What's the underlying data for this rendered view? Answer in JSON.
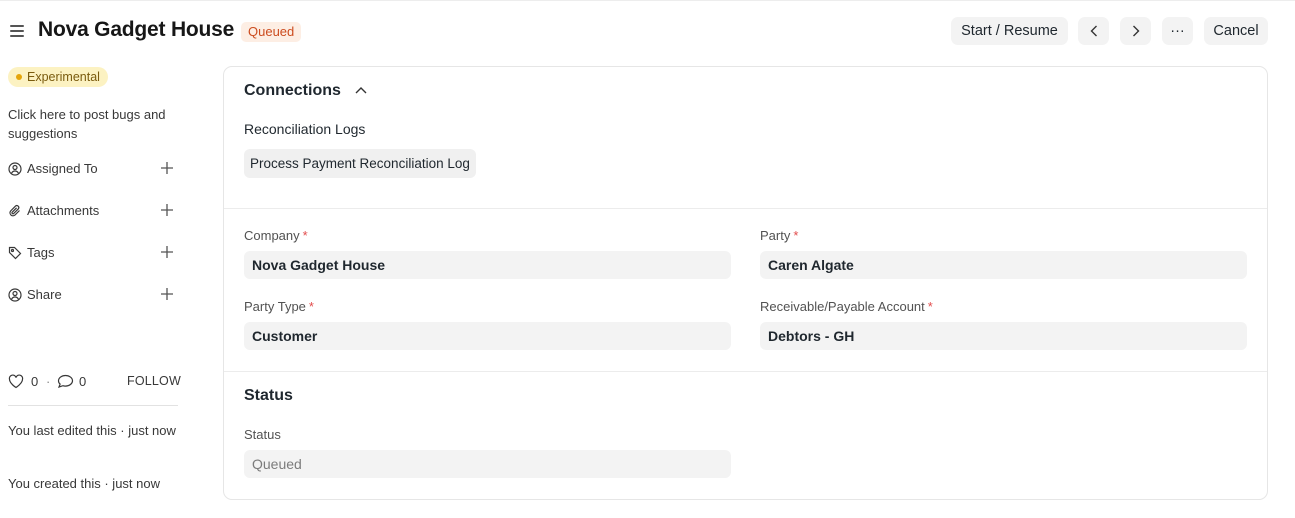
{
  "header": {
    "title": "Nova Gadget House",
    "status": "Queued",
    "buttons": {
      "start": "Start / Resume",
      "more": "···",
      "cancel": "Cancel"
    }
  },
  "sidebar": {
    "experimental": "Experimental",
    "bugs_link": "Click here to post bugs and suggestions",
    "items": [
      {
        "label": "Assigned To",
        "icon": "user-plus-icon"
      },
      {
        "label": "Attachments",
        "icon": "paperclip-icon"
      },
      {
        "label": "Tags",
        "icon": "tag-icon"
      },
      {
        "label": "Share",
        "icon": "share-user-icon"
      }
    ],
    "likes": "0",
    "separator": "·",
    "comments": "0",
    "follow": "FOLLOW",
    "last_edited": "You last edited this · just now",
    "created": "You created this · just now"
  },
  "connections": {
    "title": "Connections",
    "group_label": "Reconciliation Logs",
    "chip": "Process Payment Reconciliation Log"
  },
  "form": {
    "company": {
      "label": "Company",
      "value": "Nova Gadget House",
      "required": "*"
    },
    "party": {
      "label": "Party",
      "value": "Caren Algate",
      "required": "*"
    },
    "party_type": {
      "label": "Party Type",
      "value": "Customer",
      "required": "*"
    },
    "account": {
      "label": "Receivable/Payable Account",
      "value": "Debtors - GH",
      "required": "*"
    }
  },
  "status_section": {
    "title": "Status",
    "label": "Status",
    "value": "Queued"
  },
  "colors": {
    "status_pill_bg": "#fdeee4",
    "status_pill_text": "#cc4c1f",
    "experimental_bg": "#fcf2c2",
    "required_star": "#e24c4c"
  }
}
